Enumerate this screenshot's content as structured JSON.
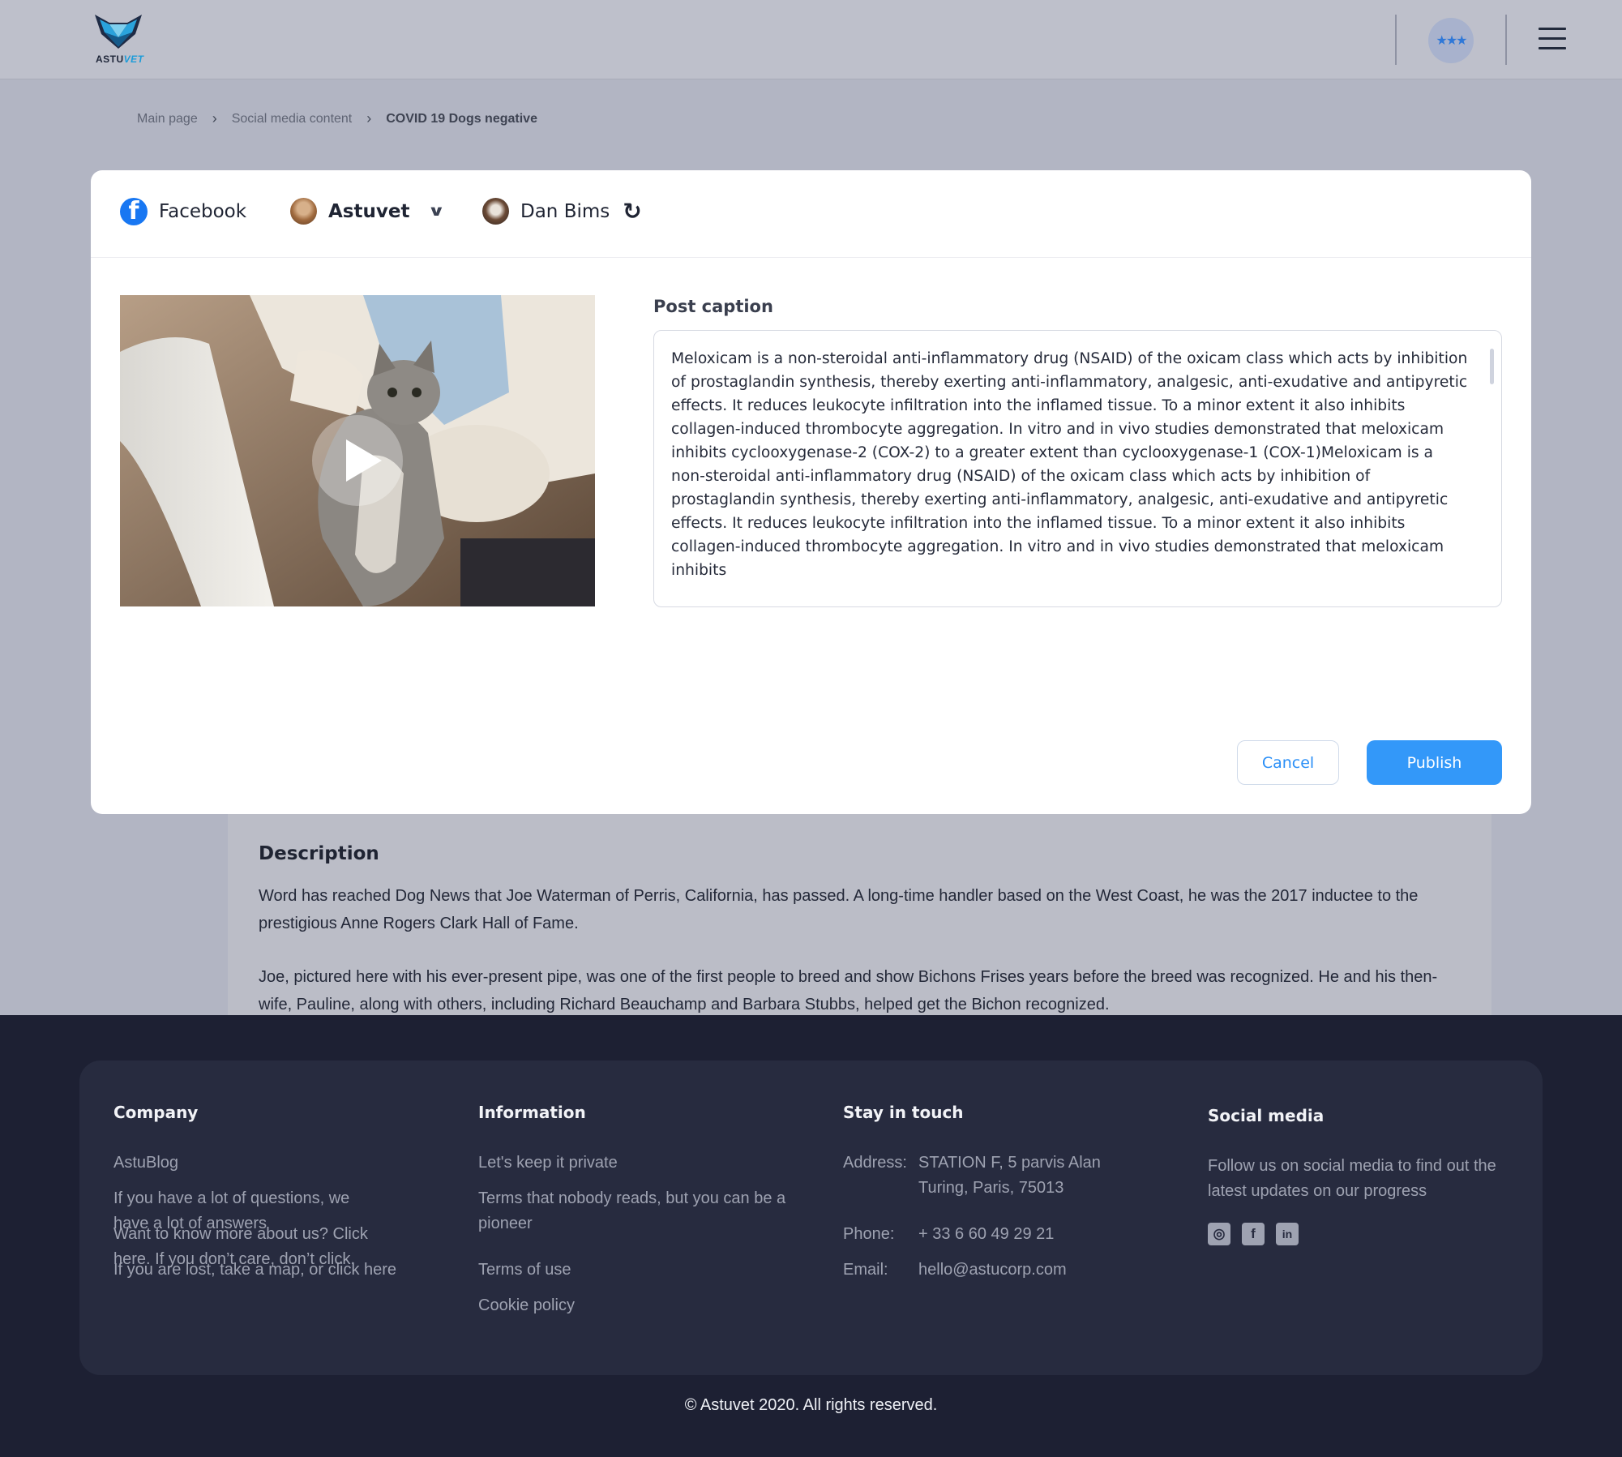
{
  "header": {
    "logo_text_main": "ASTU",
    "logo_text_accent": "VET",
    "rating_badge": "★★★"
  },
  "breadcrumb": {
    "items": [
      "Main page",
      "Social media content",
      "COVID 19 Dogs negative"
    ]
  },
  "modal": {
    "platform": "Facebook",
    "page_account": "Astuvet",
    "user_account": "Dan Bims",
    "caption_label": "Post caption",
    "caption_text": "Meloxicam is a non-steroidal anti-inflammatory drug (NSAID) of the oxicam class which acts by inhibition of prostaglandin synthesis, thereby exerting anti-inflammatory, analgesic, anti-exudative and antipyretic effects. It reduces leukocyte infiltration into the inflamed tissue. To a minor extent it also inhibits collagen-induced thrombocyte aggregation. In vitro and in vivo studies demonstrated that meloxicam inhibits cyclooxygenase-2 (COX-2) to a greater extent than cyclooxygenase-1 (COX-1)Meloxicam is a non-steroidal anti-inflammatory drug (NSAID) of the oxicam class which acts by inhibition of prostaglandin synthesis, thereby exerting anti-inflammatory, analgesic, anti-exudative and antipyretic effects. It reduces leukocyte infiltration into the inflamed tissue. To a minor extent it also inhibits collagen-induced thrombocyte aggregation. In vitro and in vivo studies demonstrated that meloxicam inhibits",
    "cancel_label": "Cancel",
    "publish_label": "Publish"
  },
  "description": {
    "title": "Description",
    "paragraphs": [
      "Word has reached Dog News that Joe Waterman of Perris, California, has passed. A long-time handler based on the West Coast, he was the 2017 inductee to the prestigious Anne Rogers Clark Hall of Fame.",
      "Joe, pictured here with his ever-present pipe, was one of the first people to breed and show Bichons Frises years before the breed was recognized. He and his then-wife, Pauline, along with others, including Richard Beauchamp and Barbara Stubbs, helped get the Bichon recognized."
    ]
  },
  "footer": {
    "company": {
      "title": "Company",
      "links": [
        "AstuBlog",
        "If you have a lot of questions, we have a lot of answers",
        "Want to know more about us? Click here. If you don’t care, don’t click.",
        "If you are lost, take a map, or click here"
      ]
    },
    "information": {
      "title": "Information",
      "links": [
        "Let's keep it private",
        "Terms that nobody reads, but you can be a pioneer",
        "Terms of use",
        "Cookie policy"
      ]
    },
    "contact": {
      "title": "Stay in touch",
      "address_label": "Address:",
      "address_value": "STATION F, 5 parvis Alan Turing, Paris, 75013",
      "phone_label": "Phone:",
      "phone_value": "+ 33 6 60 49 29 21",
      "email_label": "Email:",
      "email_value": "hello@astucorp.com"
    },
    "social": {
      "title": "Social media",
      "text": "Follow us on social media to find out the latest updates on our progress",
      "icons": [
        "instagram-icon",
        "facebook-icon",
        "linkedin-icon"
      ]
    },
    "copyright": "Astuvet 2020. All rights reserved."
  },
  "colors": {
    "accent": "#3398f9",
    "facebook": "#1877f2",
    "footer_bg": "#1d2033",
    "footer_card": "#272b3f"
  }
}
